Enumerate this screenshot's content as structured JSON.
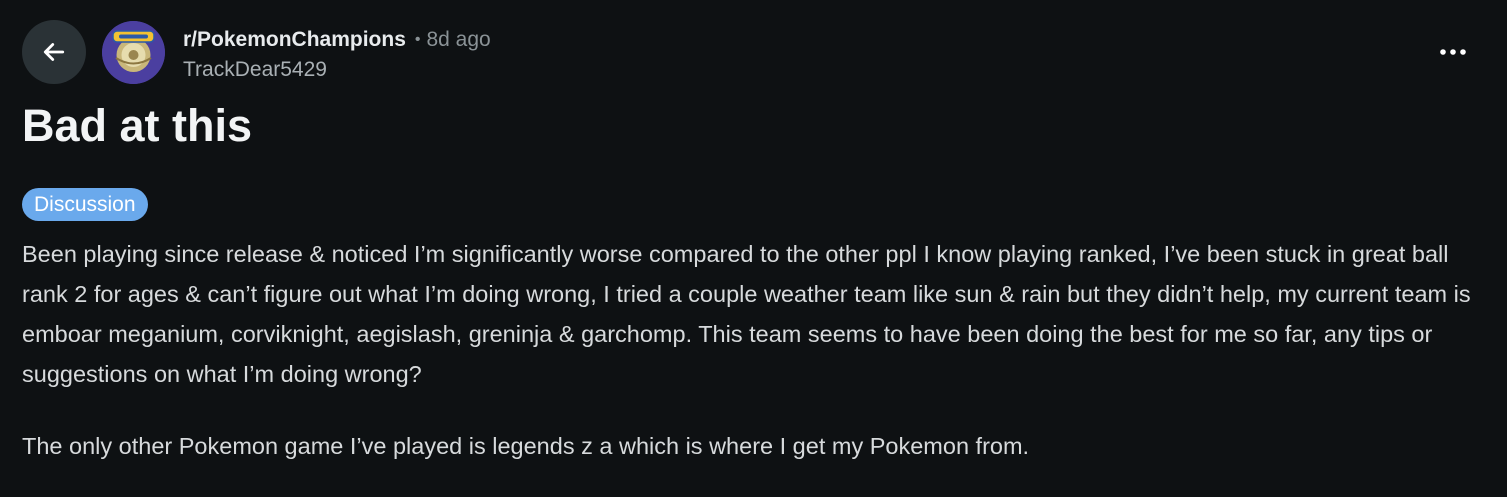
{
  "post": {
    "subreddit": "r/PokemonChampions",
    "separator": "•",
    "age": "8d ago",
    "author": "TrackDear5429",
    "title": "Bad at this",
    "flair": "Discussion",
    "paragraphs": [
      "Been playing since release & noticed I’m significantly worse compared to the other ppl I know playing ranked, I’ve been stuck in great ball rank 2 for ages & can’t figure out what I’m doing wrong, I tried a couple weather team like sun & rain but they didn’t help, my current team is emboar meganium, corviknight, aegislash, greninja & garchomp. This team seems to have been doing the best for me so far, any tips or suggestions on what I’m doing wrong?",
      "The only other Pokemon game I’ve played is legends z a which is where I get my Pokemon from."
    ]
  },
  "icons": {
    "back": "arrow-left-icon",
    "more": "more-horizontal-icon",
    "avatar": "subreddit-avatar"
  },
  "colors": {
    "background": "#0e1113",
    "flair": "#6aa9ec",
    "text": "#d7dadc",
    "muted": "#8a9296"
  }
}
